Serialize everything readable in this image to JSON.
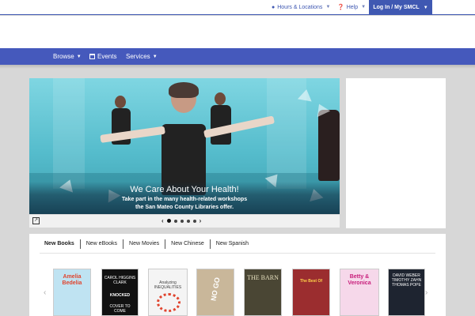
{
  "topbar": {
    "hours_label": "Hours & Locations",
    "help_label": "Help",
    "login_label": "Log In / My SMCL",
    "icons": {
      "hours": "map-pin-icon",
      "help": "question-circle-icon",
      "chevron": "chevron-down-icon"
    }
  },
  "nav": {
    "items": [
      {
        "label": "Browse",
        "dropdown": true
      },
      {
        "label": "Events",
        "icon": "calendar-icon"
      },
      {
        "label": "Services",
        "dropdown": true
      }
    ]
  },
  "hero": {
    "title": "We Care About Your Health!",
    "subtitle_line1": "Take part in the many health-related workshops",
    "subtitle_line2": "the San Mateo County Libraries offer.",
    "slide_count": 5,
    "active_slide": 1,
    "prev_glyph": "‹",
    "next_glyph": "›"
  },
  "books": {
    "tabs": [
      "New Books",
      "New eBooks",
      "New Movies",
      "New Chinese",
      "New Spanish"
    ],
    "active_tab": "New Books",
    "covers": [
      {
        "text_top": "Amelia Bedelia",
        "bg": "#bfe3f2",
        "fg": "#e0442e"
      },
      {
        "text_top": "CAROL HIGGINS CLARK",
        "text_mid": "KNOCKED",
        "text_bot": "COVER TO COME",
        "bg": "#111111",
        "fg": "#ffffff"
      },
      {
        "text_top": "Analyzing INEQUALITIES",
        "bg": "#f4f4f4",
        "fg": "#444444"
      },
      {
        "text_top": "NO GO",
        "bg": "#c9b79a",
        "fg": "#ffffff"
      },
      {
        "text_top": "THE BARN",
        "bg": "#4a4634",
        "fg": "#e8e2c0"
      },
      {
        "text_top": "The Best Of",
        "bg": "#9b2d2f",
        "fg": "#ffd24a"
      },
      {
        "text_top": "Betty & Veronica",
        "bg": "#f6d8ea",
        "fg": "#c81e7b"
      },
      {
        "text_top": "DAVID WEBER TIMOTHY ZAHN THOMAS POPE",
        "bg": "#1e2430",
        "fg": "#ffffff"
      }
    ]
  },
  "colors": {
    "brand": "#4559bc",
    "accent": "#3f58b2",
    "page_bg": "#d7d7d7"
  }
}
